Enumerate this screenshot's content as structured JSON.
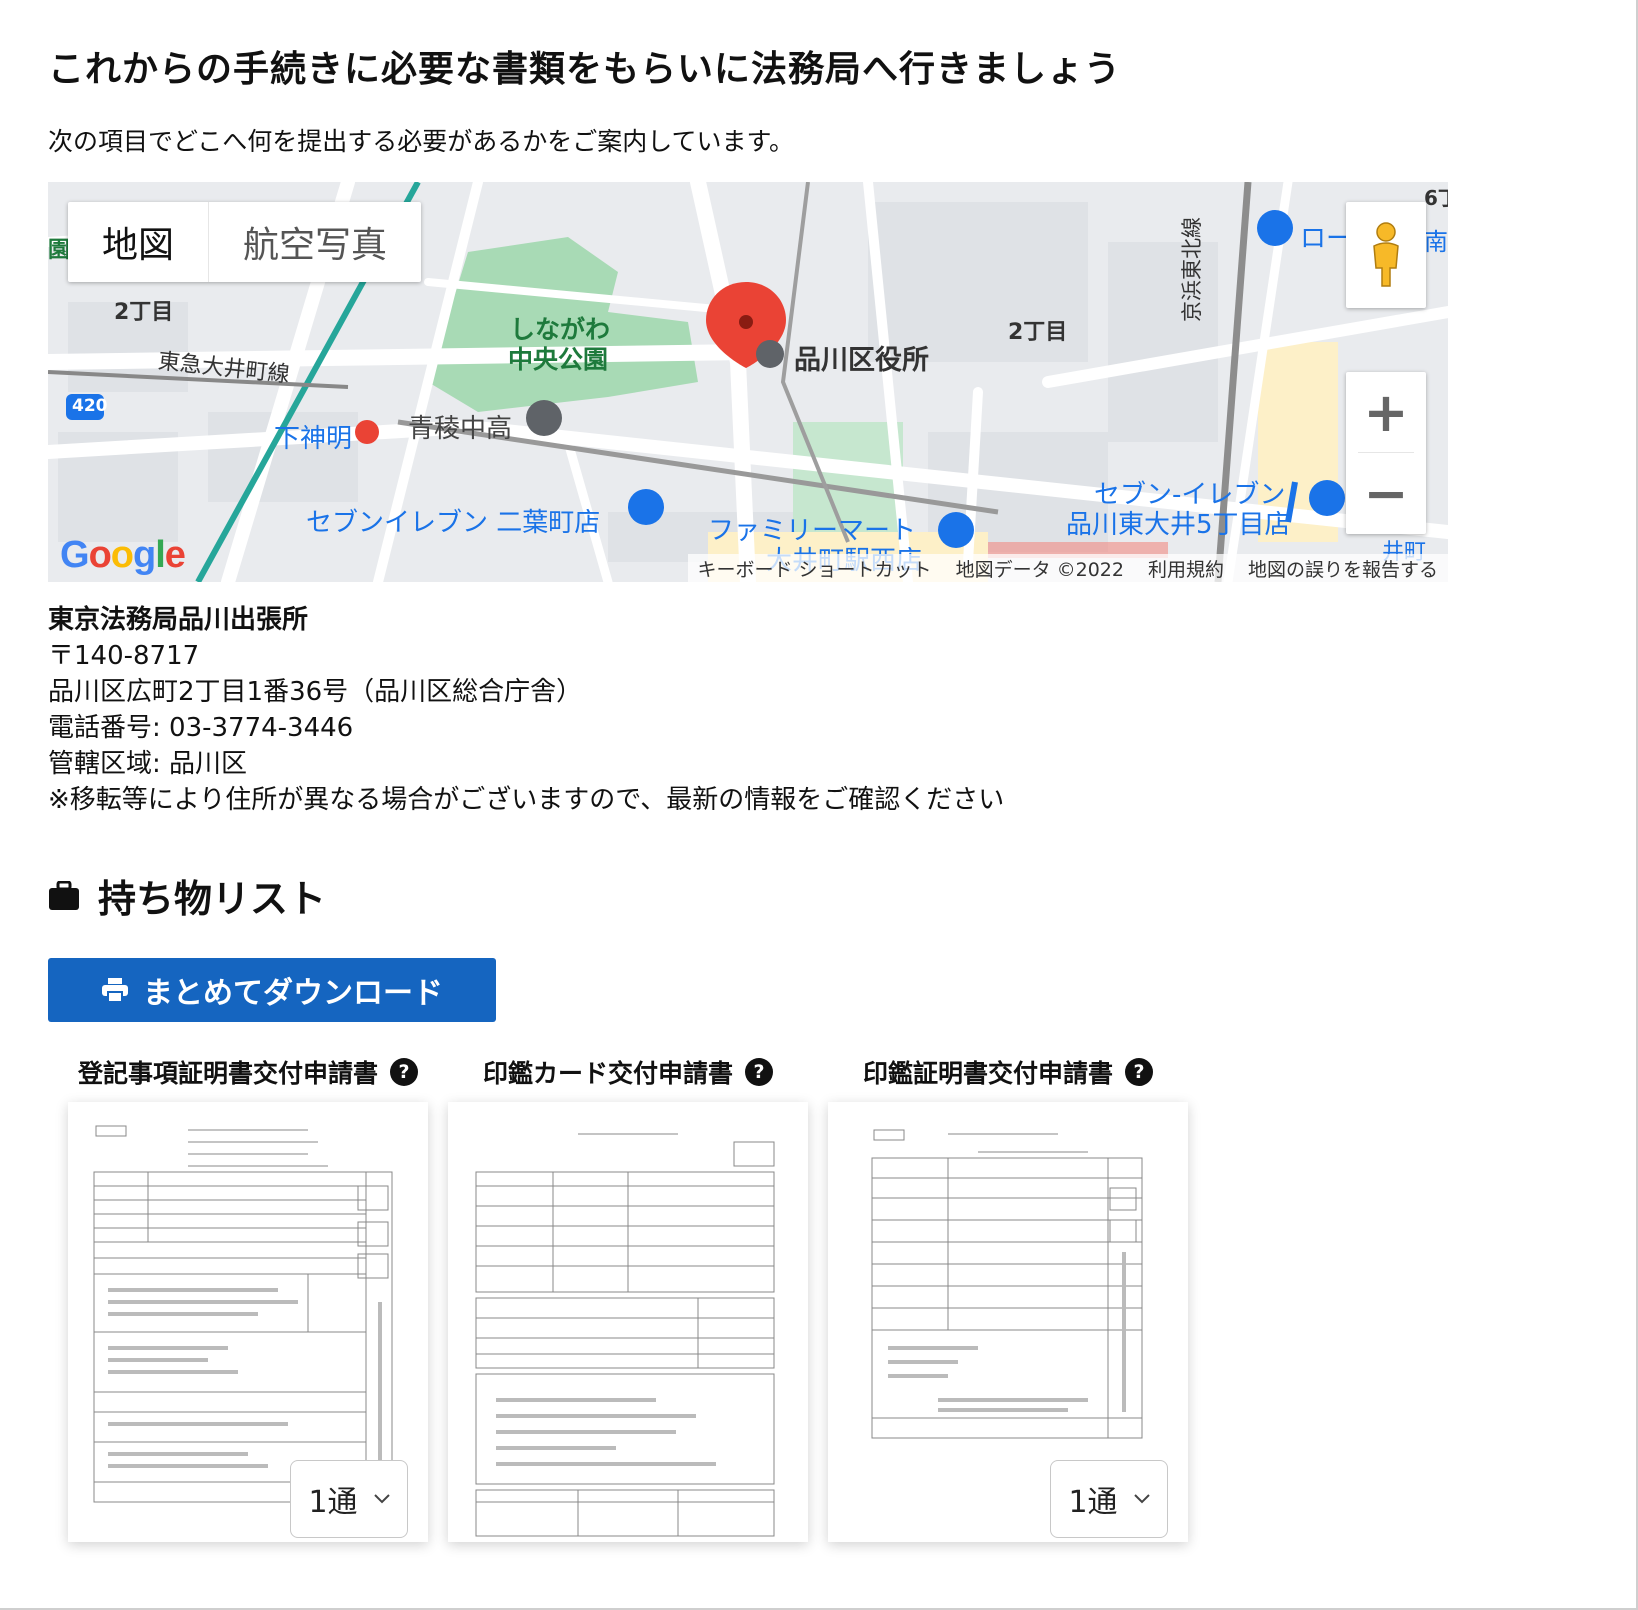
{
  "heading": "これからの手続きに必要な書類をもらいに法務局へ行きましょう",
  "lead": "次の項目でどこへ何を提出する必要があるかをご案内しています。",
  "map": {
    "type_map": "地図",
    "type_satellite": "航空写真",
    "zoom_in": "+",
    "zoom_out": "−",
    "google": "Google",
    "attribution": {
      "shortcuts": "キーボード ショートカット",
      "data": "地図データ ©2022",
      "terms": "利用規約",
      "report": "地図の誤りを報告する"
    },
    "labels": {
      "park_line1": "しながわ",
      "park_line2": "中央公園",
      "ward_office": "品川区役所",
      "chome_left": "2丁目",
      "chome_right": "2丁目",
      "tokyu_line": "東急大井町線",
      "route_no": "420",
      "station": "下神明",
      "school": "青稜中高",
      "seven_futaba": "セブンイレブン 二葉町店",
      "familymart_1": "ファミリーマート",
      "familymart_2": "大井町駅西店",
      "seven_oi_1": "セブン-イレブン",
      "seven_oi_2": "品川東大井5丁目店",
      "keihin_line": "京浜東北線",
      "lawson": "ロー",
      "edge_6": "6丁",
      "edge_minami": "南",
      "edge_en": "園",
      "edge_imachi": "井町"
    }
  },
  "office": {
    "name": "東京法務局品川出張所",
    "postal": "〒140-8717",
    "address": "品川区広町2丁目1番36号（品川区総合庁舎）",
    "phone": "電話番号: 03-3774-3446",
    "jurisdiction": "管轄区域: 品川区",
    "note": "※移転等により住所が異なる場合がございますので、最新の情報をご確認ください"
  },
  "belongings": {
    "title": "持ち物リスト",
    "download_label": "まとめてダウンロード"
  },
  "documents": [
    {
      "title": "登記事項証明書交付申請書",
      "qty": "1通"
    },
    {
      "title": "印鑑カード交付申請書"
    },
    {
      "title": "印鑑証明書交付申請書",
      "qty": "1通"
    }
  ],
  "colors": {
    "primary": "#1565c0",
    "park": "#a8dab5",
    "pin": "#ea4335",
    "poi_blue": "#1a73e8"
  }
}
